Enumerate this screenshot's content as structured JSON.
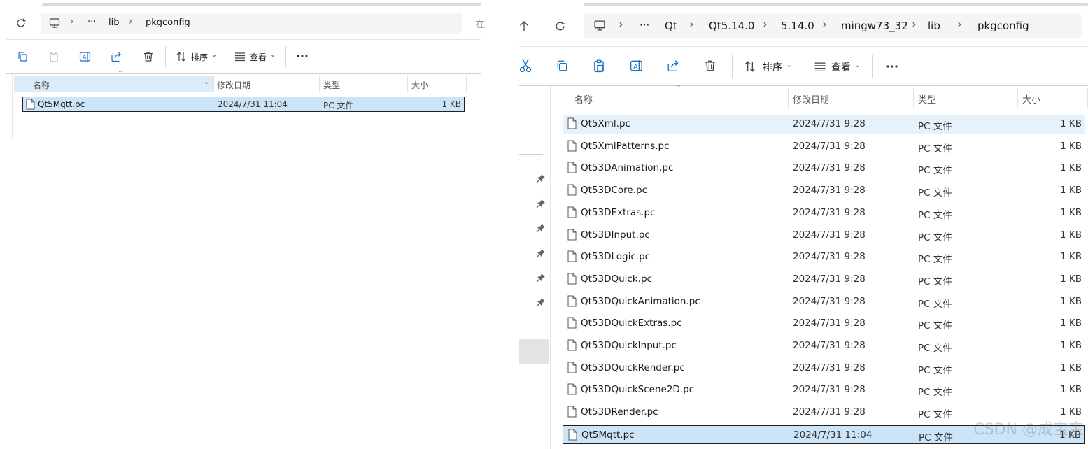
{
  "left_window": {
    "breadcrumb": [
      "···",
      "lib",
      "pkgconfig"
    ],
    "toolbar": {
      "sort_label": "排序",
      "view_label": "查看"
    },
    "columns": {
      "name": "名称",
      "date": "修改日期",
      "type": "类型",
      "size": "大小"
    },
    "files": [
      {
        "name": "Qt5Mqtt.pc",
        "date": "2024/7/31 11:04",
        "type": "PC 文件",
        "size": "1 KB"
      }
    ],
    "cut_text": "在"
  },
  "right_window": {
    "breadcrumb": [
      "···",
      "Qt",
      "Qt5.14.0",
      "5.14.0",
      "mingw73_32",
      "lib",
      "pkgconfig"
    ],
    "toolbar": {
      "sort_label": "排序",
      "view_label": "查看"
    },
    "columns": {
      "name": "名称",
      "date": "修改日期",
      "type": "类型",
      "size": "大小"
    },
    "files": [
      {
        "name": "Qt5Xml.pc",
        "date": "2024/7/31 9:28",
        "type": "PC 文件",
        "size": "1 KB"
      },
      {
        "name": "Qt5XmlPatterns.pc",
        "date": "2024/7/31 9:28",
        "type": "PC 文件",
        "size": "1 KB"
      },
      {
        "name": "Qt53DAnimation.pc",
        "date": "2024/7/31 9:28",
        "type": "PC 文件",
        "size": "1 KB"
      },
      {
        "name": "Qt53DCore.pc",
        "date": "2024/7/31 9:28",
        "type": "PC 文件",
        "size": "1 KB"
      },
      {
        "name": "Qt53DExtras.pc",
        "date": "2024/7/31 9:28",
        "type": "PC 文件",
        "size": "1 KB"
      },
      {
        "name": "Qt53DInput.pc",
        "date": "2024/7/31 9:28",
        "type": "PC 文件",
        "size": "1 KB"
      },
      {
        "name": "Qt53DLogic.pc",
        "date": "2024/7/31 9:28",
        "type": "PC 文件",
        "size": "1 KB"
      },
      {
        "name": "Qt53DQuick.pc",
        "date": "2024/7/31 9:28",
        "type": "PC 文件",
        "size": "1 KB"
      },
      {
        "name": "Qt53DQuickAnimation.pc",
        "date": "2024/7/31 9:28",
        "type": "PC 文件",
        "size": "1 KB"
      },
      {
        "name": "Qt53DQuickExtras.pc",
        "date": "2024/7/31 9:28",
        "type": "PC 文件",
        "size": "1 KB"
      },
      {
        "name": "Qt53DQuickInput.pc",
        "date": "2024/7/31 9:28",
        "type": "PC 文件",
        "size": "1 KB"
      },
      {
        "name": "Qt53DQuickRender.pc",
        "date": "2024/7/31 9:28",
        "type": "PC 文件",
        "size": "1 KB"
      },
      {
        "name": "Qt53DQuickScene2D.pc",
        "date": "2024/7/31 9:28",
        "type": "PC 文件",
        "size": "1 KB"
      },
      {
        "name": "Qt53DRender.pc",
        "date": "2024/7/31 9:28",
        "type": "PC 文件",
        "size": "1 KB"
      },
      {
        "name": "Qt5Mqtt.pc",
        "date": "2024/7/31 11:04",
        "type": "PC 文件",
        "size": "1 KB"
      }
    ],
    "selected_file": "Qt5Mqtt.pc",
    "hover_file": "Qt5Xml.pc"
  },
  "watermark": "CSDN @成宝宝",
  "colors": {
    "selection": "#cce4f7",
    "hover": "#e5f1fb",
    "header_sort": "#dcecfb"
  }
}
